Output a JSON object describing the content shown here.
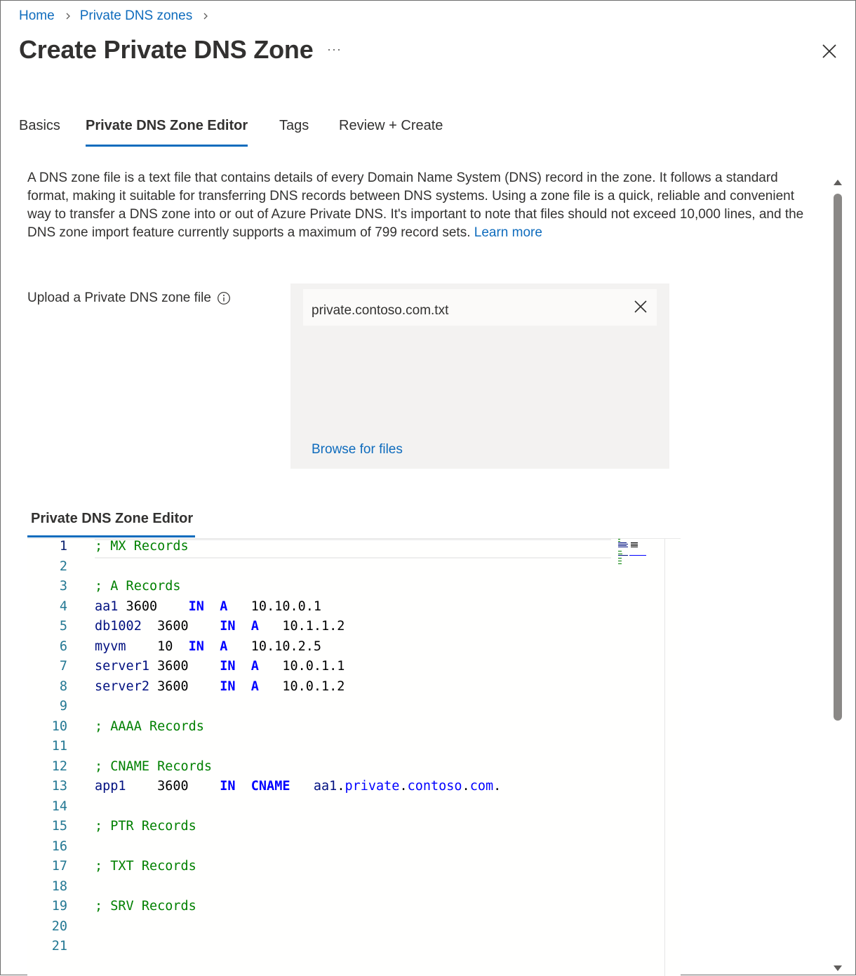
{
  "breadcrumb": {
    "home": "Home",
    "zones": "Private DNS zones"
  },
  "page_title": "Create Private DNS Zone",
  "more_label": "···",
  "tabs": [
    {
      "label": "Basics"
    },
    {
      "label": "Private DNS Zone Editor"
    },
    {
      "label": "Tags"
    },
    {
      "label": "Review + Create"
    }
  ],
  "active_tab": "Private DNS Zone Editor",
  "description": {
    "text": "A DNS zone file is a text file that contains details of every Domain Name System (DNS) record in the zone. It follows a standard format, making it suitable for transferring DNS records between DNS systems. Using a zone file is a quick, reliable and convenient way to transfer a DNS zone into or out of Azure Private DNS. It's important to note that files should not exceed 10,000 lines, and the DNS zone import feature currently supports a maximum of 799 record sets.",
    "link": "Learn more"
  },
  "upload": {
    "label": "Upload a Private DNS zone file",
    "file_name": "private.contoso.com.txt",
    "browse_label": "Browse for files"
  },
  "editor": {
    "heading": "Private DNS Zone Editor",
    "current_line": 1,
    "lines": [
      {
        "num": "1",
        "tokens": [
          {
            "t": "; MX Records",
            "c": "comment"
          }
        ]
      },
      {
        "num": "2",
        "tokens": []
      },
      {
        "num": "3",
        "tokens": [
          {
            "t": "; A Records",
            "c": "comment"
          }
        ]
      },
      {
        "num": "4",
        "tokens": [
          {
            "t": "aa1",
            "c": "name"
          },
          {
            "t": " 3600    ",
            "c": "plain"
          },
          {
            "t": "IN",
            "c": "kw"
          },
          {
            "t": "  ",
            "c": "plain"
          },
          {
            "t": "A",
            "c": "kw"
          },
          {
            "t": "   10.10.0.1",
            "c": "plain"
          }
        ]
      },
      {
        "num": "5",
        "tokens": [
          {
            "t": "db1002",
            "c": "name"
          },
          {
            "t": "  3600    ",
            "c": "plain"
          },
          {
            "t": "IN",
            "c": "kw"
          },
          {
            "t": "  ",
            "c": "plain"
          },
          {
            "t": "A",
            "c": "kw"
          },
          {
            "t": "   10.1.1.2",
            "c": "plain"
          }
        ]
      },
      {
        "num": "6",
        "tokens": [
          {
            "t": "myvm",
            "c": "name"
          },
          {
            "t": "    10  ",
            "c": "plain"
          },
          {
            "t": "IN",
            "c": "kw"
          },
          {
            "t": "  ",
            "c": "plain"
          },
          {
            "t": "A",
            "c": "kw"
          },
          {
            "t": "   10.10.2.5",
            "c": "plain"
          }
        ]
      },
      {
        "num": "7",
        "tokens": [
          {
            "t": "server1",
            "c": "name"
          },
          {
            "t": " 3600    ",
            "c": "plain"
          },
          {
            "t": "IN",
            "c": "kw"
          },
          {
            "t": "  ",
            "c": "plain"
          },
          {
            "t": "A",
            "c": "kw"
          },
          {
            "t": "   10.0.1.1",
            "c": "plain"
          }
        ]
      },
      {
        "num": "8",
        "tokens": [
          {
            "t": "server2",
            "c": "name"
          },
          {
            "t": " 3600    ",
            "c": "plain"
          },
          {
            "t": "IN",
            "c": "kw"
          },
          {
            "t": "  ",
            "c": "plain"
          },
          {
            "t": "A",
            "c": "kw"
          },
          {
            "t": "   10.0.1.2",
            "c": "plain"
          }
        ]
      },
      {
        "num": "9",
        "tokens": []
      },
      {
        "num": "10",
        "tokens": [
          {
            "t": "; AAAA Records",
            "c": "comment"
          }
        ]
      },
      {
        "num": "11",
        "tokens": []
      },
      {
        "num": "12",
        "tokens": [
          {
            "t": "; CNAME Records",
            "c": "comment"
          }
        ]
      },
      {
        "num": "13",
        "tokens": [
          {
            "t": "app1",
            "c": "name"
          },
          {
            "t": "    3600    ",
            "c": "plain"
          },
          {
            "t": "IN",
            "c": "kw"
          },
          {
            "t": "  ",
            "c": "plain"
          },
          {
            "t": "CNAME",
            "c": "kw"
          },
          {
            "t": "   ",
            "c": "plain"
          },
          {
            "t": "aa1",
            "c": "name"
          },
          {
            "t": ".",
            "c": "sep"
          },
          {
            "t": "private",
            "c": "kwlight"
          },
          {
            "t": ".",
            "c": "sep"
          },
          {
            "t": "contoso",
            "c": "kwlight"
          },
          {
            "t": ".",
            "c": "sep"
          },
          {
            "t": "com",
            "c": "kwlight"
          },
          {
            "t": ".",
            "c": "sep"
          }
        ]
      },
      {
        "num": "14",
        "tokens": []
      },
      {
        "num": "15",
        "tokens": [
          {
            "t": "; PTR Records",
            "c": "comment"
          }
        ]
      },
      {
        "num": "16",
        "tokens": []
      },
      {
        "num": "17",
        "tokens": [
          {
            "t": "; TXT Records",
            "c": "comment"
          }
        ]
      },
      {
        "num": "18",
        "tokens": []
      },
      {
        "num": "19",
        "tokens": [
          {
            "t": "; SRV Records",
            "c": "comment"
          }
        ]
      },
      {
        "num": "20",
        "tokens": []
      },
      {
        "num": "21",
        "tokens": []
      }
    ]
  },
  "colors": {
    "accent": "#0f6cbd",
    "comment": "#008000",
    "keyword": "#0000ff",
    "identifier": "#001080",
    "line_number": "#237893",
    "dropzone_bg": "#f3f2f1"
  },
  "icons": {
    "breadcrumb_sep": "chevron-right-icon",
    "close": "close-icon",
    "info": "info-icon",
    "remove_file": "close-icon"
  }
}
